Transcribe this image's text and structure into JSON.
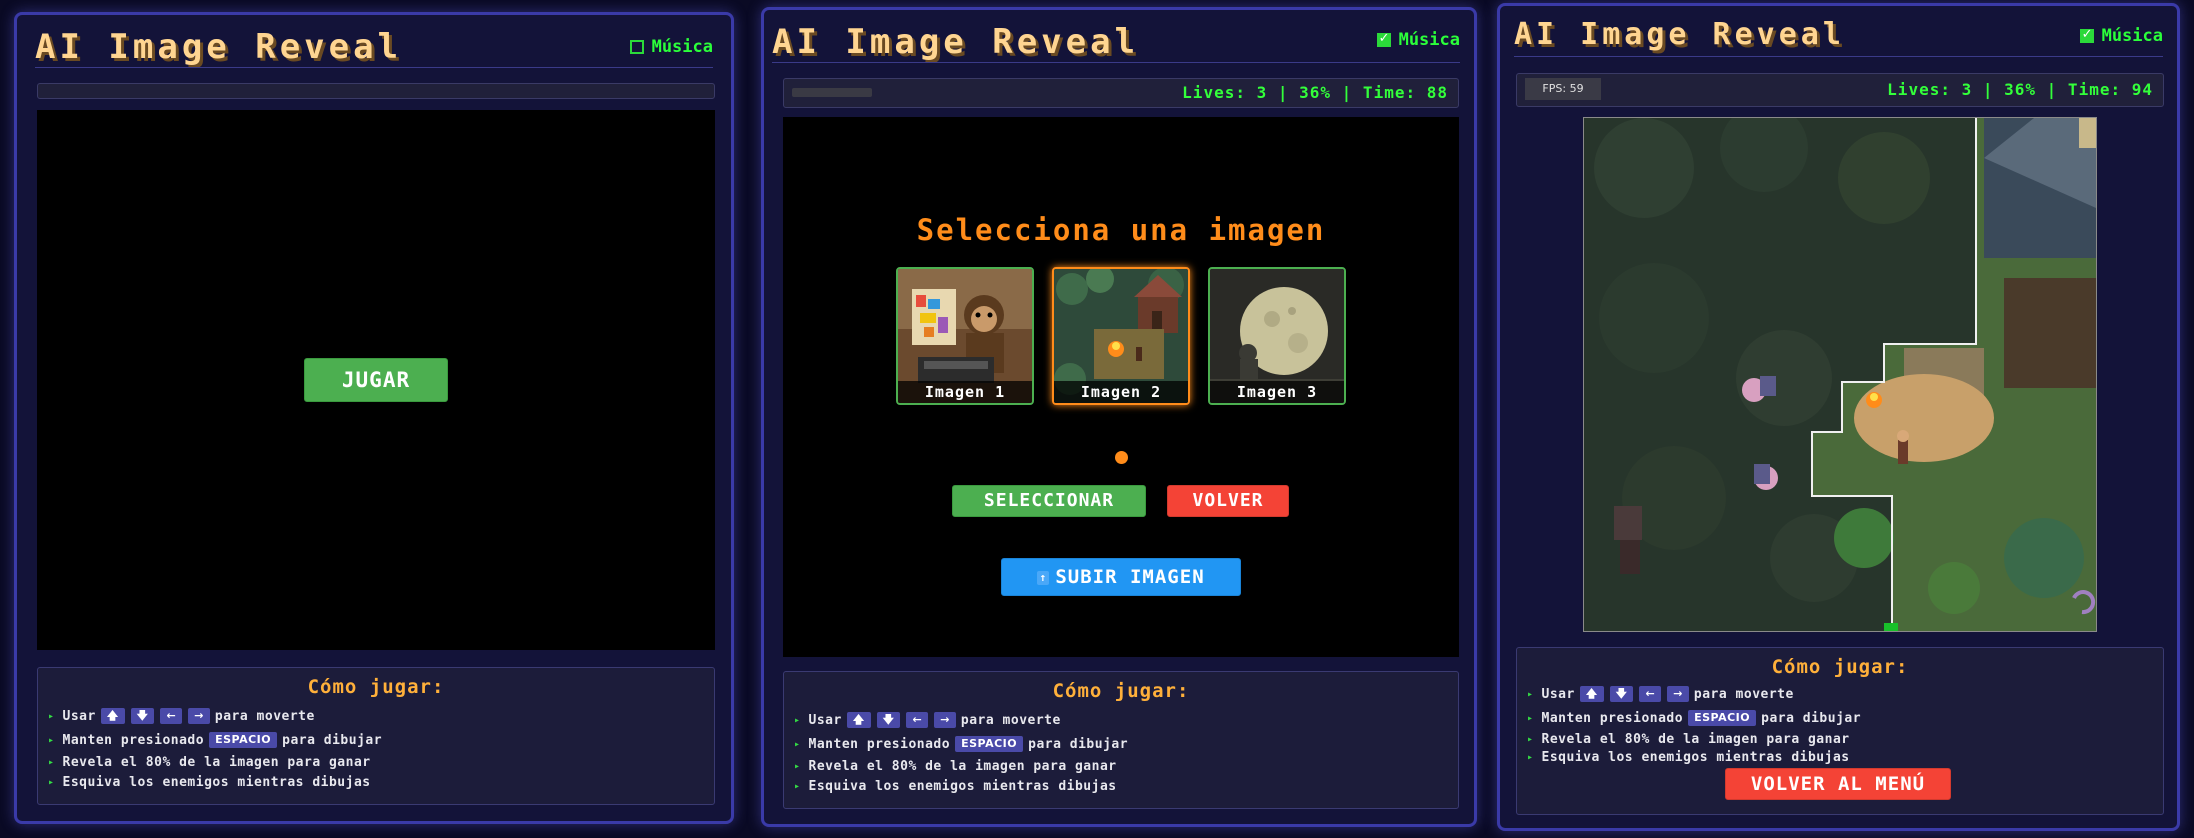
{
  "app_title": "AI Image Reveal",
  "music_label": "Música",
  "panel1": {
    "music_on": false,
    "play_button": "JUGAR"
  },
  "panel2": {
    "music_on": true,
    "status": "Lives: 3 | 36% | Time: 88",
    "select_title": "Selecciona una imagen",
    "images": [
      "Imagen 1",
      "Imagen 2",
      "Imagen 3"
    ],
    "selected_index": 1,
    "select_button": "SELECCIONAR",
    "back_button": "VOLVER",
    "upload_icon": "upload-arrow-icon",
    "upload_button": "SUBIR IMAGEN"
  },
  "panel3": {
    "music_on": true,
    "fps": "FPS: 59",
    "status": "Lives: 3 | 36% | Time: 94",
    "menu_button": "VOLVER AL MENÚ"
  },
  "howto": {
    "title": "Cómo jugar:",
    "move_pre": "Usar",
    "move_post": "para moverte",
    "keys": [
      "🡅",
      "🡇",
      "←",
      "→"
    ],
    "hold_pre": "Manten presionado",
    "space_key": "ESPACIO",
    "hold_post": "para dibujar",
    "reveal": "Revela el 80% de la imagen para ganar",
    "avoid": "Esquiva los enemigos mientras dibujas"
  },
  "colors": {
    "accent_green": "#4caf50",
    "accent_red": "#f44336",
    "accent_blue": "#2196f3",
    "title_gold": "#ffd591",
    "status_green": "#33ff3a",
    "select_orange": "#ff8c1a"
  }
}
